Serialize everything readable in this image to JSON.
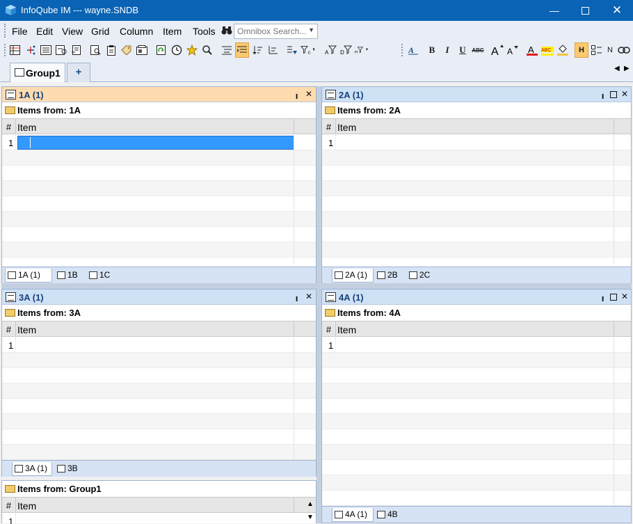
{
  "window": {
    "title": "InfoQube IM  ---  wayne.SNDB",
    "controls": [
      "minimize",
      "maximize",
      "close"
    ]
  },
  "menubar": {
    "items": [
      {
        "label": "File"
      },
      {
        "label": "Edit"
      },
      {
        "label": "View"
      },
      {
        "label": "Grid"
      },
      {
        "label": "Column"
      },
      {
        "label": "Item"
      },
      {
        "label": "Tools"
      }
    ],
    "omnibox_placeholder": "Omnibox Search..."
  },
  "toolbar": {
    "format": {
      "bold": "B",
      "italic": "I",
      "underline": "U",
      "strike": "ABC",
      "highlight": "H",
      "normal": "N",
      "abc_highlight": "ABC"
    }
  },
  "group_tabs": {
    "tabs": [
      {
        "label": "Group1"
      }
    ],
    "add_label": "+"
  },
  "panes": {
    "p1": {
      "title": "1A (1)",
      "items_from_prefix": "Items from:",
      "source": "1A",
      "column": "Item",
      "hash": "#",
      "rows": [
        "1"
      ],
      "tabs": [
        "1A (1)",
        "1B",
        "1C"
      ]
    },
    "p2": {
      "title": "2A (1)",
      "items_from_prefix": "Items from:",
      "source": "2A",
      "column": "Item",
      "hash": "#",
      "rows": [
        "1"
      ],
      "tabs": [
        "2A (1)",
        "2B",
        "2C"
      ]
    },
    "p3": {
      "title": "3A (1)",
      "items_from_prefix": "Items from:",
      "source": "3A",
      "column": "Item",
      "hash": "#",
      "rows": [
        "1"
      ],
      "tabs": [
        "3A (1)",
        "3B"
      ]
    },
    "p4": {
      "title": "4A (1)",
      "items_from_prefix": "Items from:",
      "source": "4A",
      "column": "Item",
      "hash": "#",
      "rows": [
        "1"
      ],
      "tabs": [
        "4A (1)",
        "4B"
      ]
    },
    "p5": {
      "items_from_prefix": "Items from:",
      "source": "Group1",
      "column": "Item",
      "hash": "#",
      "rows": [
        "1"
      ]
    }
  },
  "colors": {
    "titlebar": "#0a63b4",
    "active_pane": "#ffdcb0",
    "pane_header": "#cfe1f5",
    "selection": "#3399ff"
  }
}
